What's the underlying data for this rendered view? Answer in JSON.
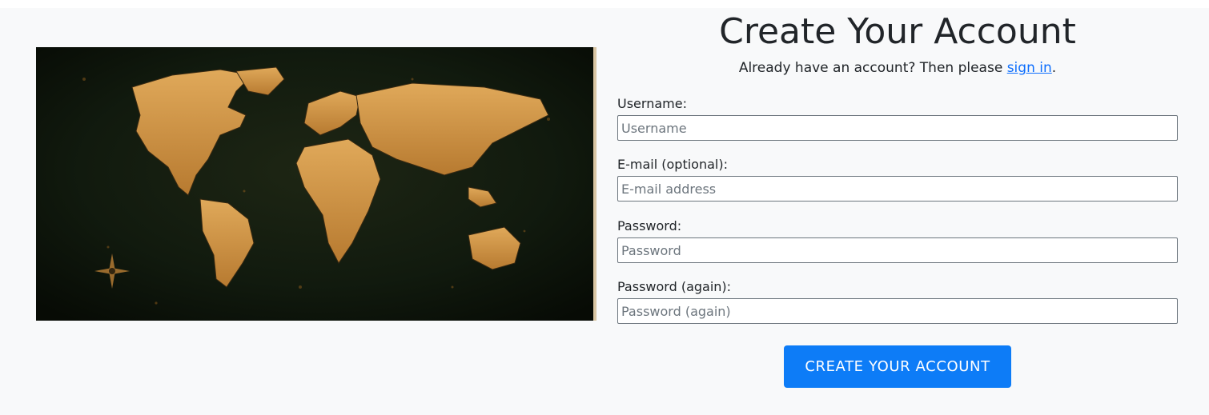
{
  "form": {
    "title": "Create Your Account",
    "subtitle_prefix": "Already have an account? Then please ",
    "signin_link": "sign in",
    "subtitle_suffix": ".",
    "fields": [
      {
        "label": "Username:",
        "placeholder": "Username",
        "value": ""
      },
      {
        "label": "E-mail (optional):",
        "placeholder": "E-mail address",
        "value": ""
      },
      {
        "label": "Password:",
        "placeholder": "Password",
        "value": ""
      },
      {
        "label": "Password (again):",
        "placeholder": "Password (again)",
        "value": ""
      }
    ],
    "submit_label": "CREATE YOUR ACCOUNT"
  },
  "hero": {
    "image": "world-map-image"
  },
  "colors": {
    "accent": "#0d7cf7",
    "link": "#0d6efd",
    "background": "#f8f9fa",
    "map_land": "#c98f3e",
    "map_sea": "#0c1209"
  }
}
